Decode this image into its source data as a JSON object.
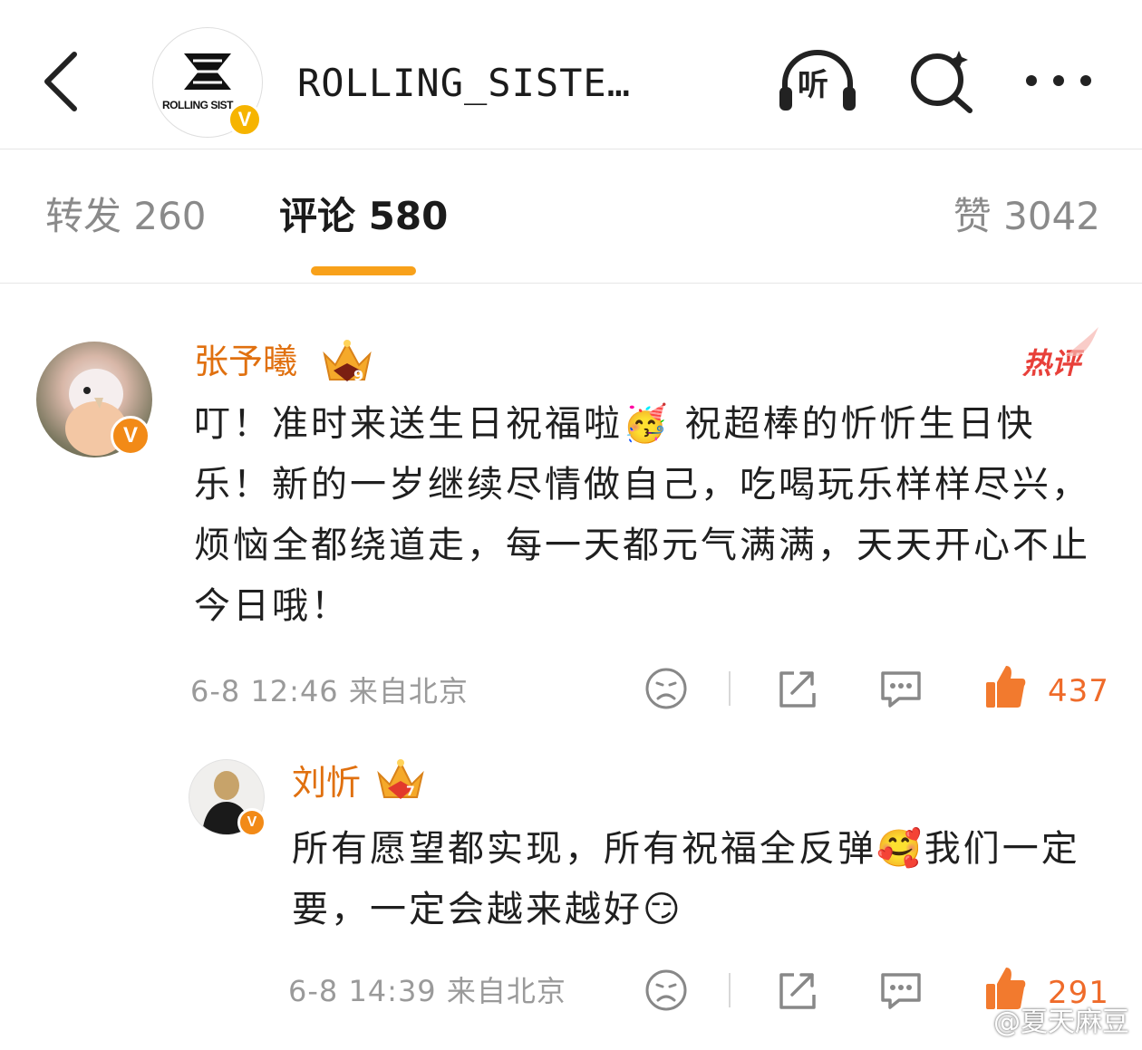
{
  "header": {
    "page_title": "ROLLING_SISTE…",
    "avatar_logo_text": "ROLLING SIST",
    "avatar_badge": "V",
    "listen_label": "听"
  },
  "tabs": [
    {
      "label": "转发 260"
    },
    {
      "label": "评论 580"
    },
    {
      "label": "赞 3042"
    }
  ],
  "comments": [
    {
      "username": "张予曦",
      "level": "9",
      "hot_label": "热评",
      "text": "叮！准时来送生日祝福啦🥳 祝超棒的忻忻生日快乐！新的一岁继续尽情做自己，吃喝玩乐样样尽兴，烦恼全都绕道走，每一天都元气满满，天天开心不止今日哦！",
      "meta": "6-8 12:46 来自北京",
      "like_count": "437"
    },
    {
      "username": "刘忻",
      "level": "7",
      "text": "所有愿望都实现，所有祝福全反弹🥰我们一定要，一定会越来越好😏",
      "meta": "6-8 14:39 来自北京",
      "like_count": "291"
    }
  ],
  "watermark": "@夏天麻豆",
  "colors": {
    "accent": "#f8a11a",
    "username": "#e0700f",
    "like": "#ef6b2a",
    "hot": "#e8403a",
    "verified": "#f6b400"
  }
}
